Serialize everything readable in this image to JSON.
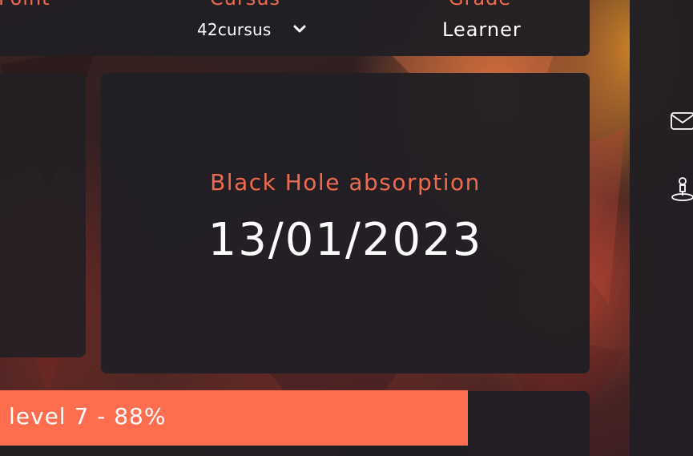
{
  "header": {
    "left_label_partial": "Point",
    "cursus_label_partial": "Cursus",
    "grade_label_partial": "Grade",
    "cursus_value": "42cursus",
    "grade_value": "Learner"
  },
  "blackhole": {
    "title": "Black Hole absorption",
    "date": "13/01/2023"
  },
  "level": {
    "text": "level 7 - 88%",
    "progress_fraction": 0.88
  },
  "icons": {
    "mail": "mail-icon",
    "location": "location-pin-icon",
    "chevron": "chevron-down-icon"
  },
  "colors": {
    "accent": "#ff6d4f",
    "accent_text": "#f06b4e",
    "panel": "#221f24",
    "text": "#ffffff"
  }
}
